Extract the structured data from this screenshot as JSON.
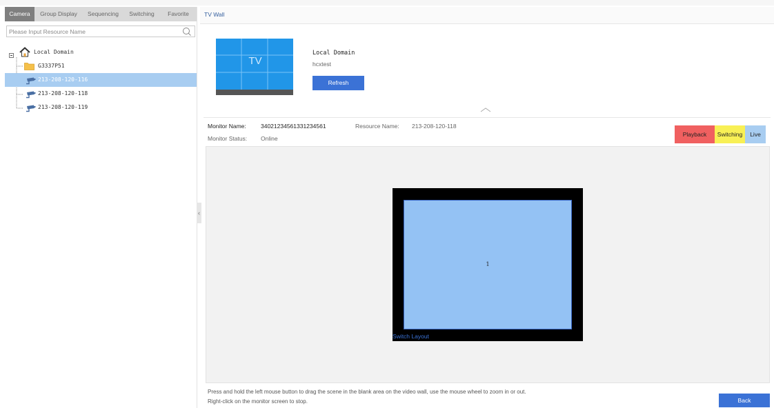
{
  "tabs": [
    "Camera",
    "Group Display",
    "Sequencing",
    "Switching",
    "Favorite"
  ],
  "search": {
    "placeholder": "Please Input Resource Name"
  },
  "tree": {
    "root": "Local Domain",
    "items": [
      "G3337P51",
      "213-208-120-116",
      "213-208-120-118",
      "213-208-120-119"
    ]
  },
  "tvwall": {
    "title": "TV Wall",
    "thumb_label": "TV",
    "domain_name": "Local Domain",
    "domain_sub": "hcxtest",
    "refresh_label": "Refresh"
  },
  "monitor": {
    "name_label": "Monitor Name:",
    "name_value": "34021234561331234561",
    "resource_label": "Resource Name:",
    "resource_value": "213-208-120-118",
    "status_label": "Monitor Status:",
    "status_value": "Online"
  },
  "modes": [
    {
      "label": "Playback",
      "color": "#f06060"
    },
    {
      "label": "Switching",
      "color": "#f8f055"
    },
    {
      "label": "Live",
      "color": "#a8cdf1"
    }
  ],
  "stage": {
    "window_number": "1",
    "switch_layout_label": "Switch Layout"
  },
  "hints": [
    "Press and hold the left mouse button to drag the scene in the blank area on the video wall, use the mouse wheel to zoom in or out.",
    "Right-click on the monitor screen to stop."
  ],
  "back_label": "Back",
  "colors": {
    "accent": "#3b72d6",
    "selected_row": "#a8cdf1",
    "thumb_blue": "#2196e8",
    "screen_blue": "#94c2f4"
  }
}
